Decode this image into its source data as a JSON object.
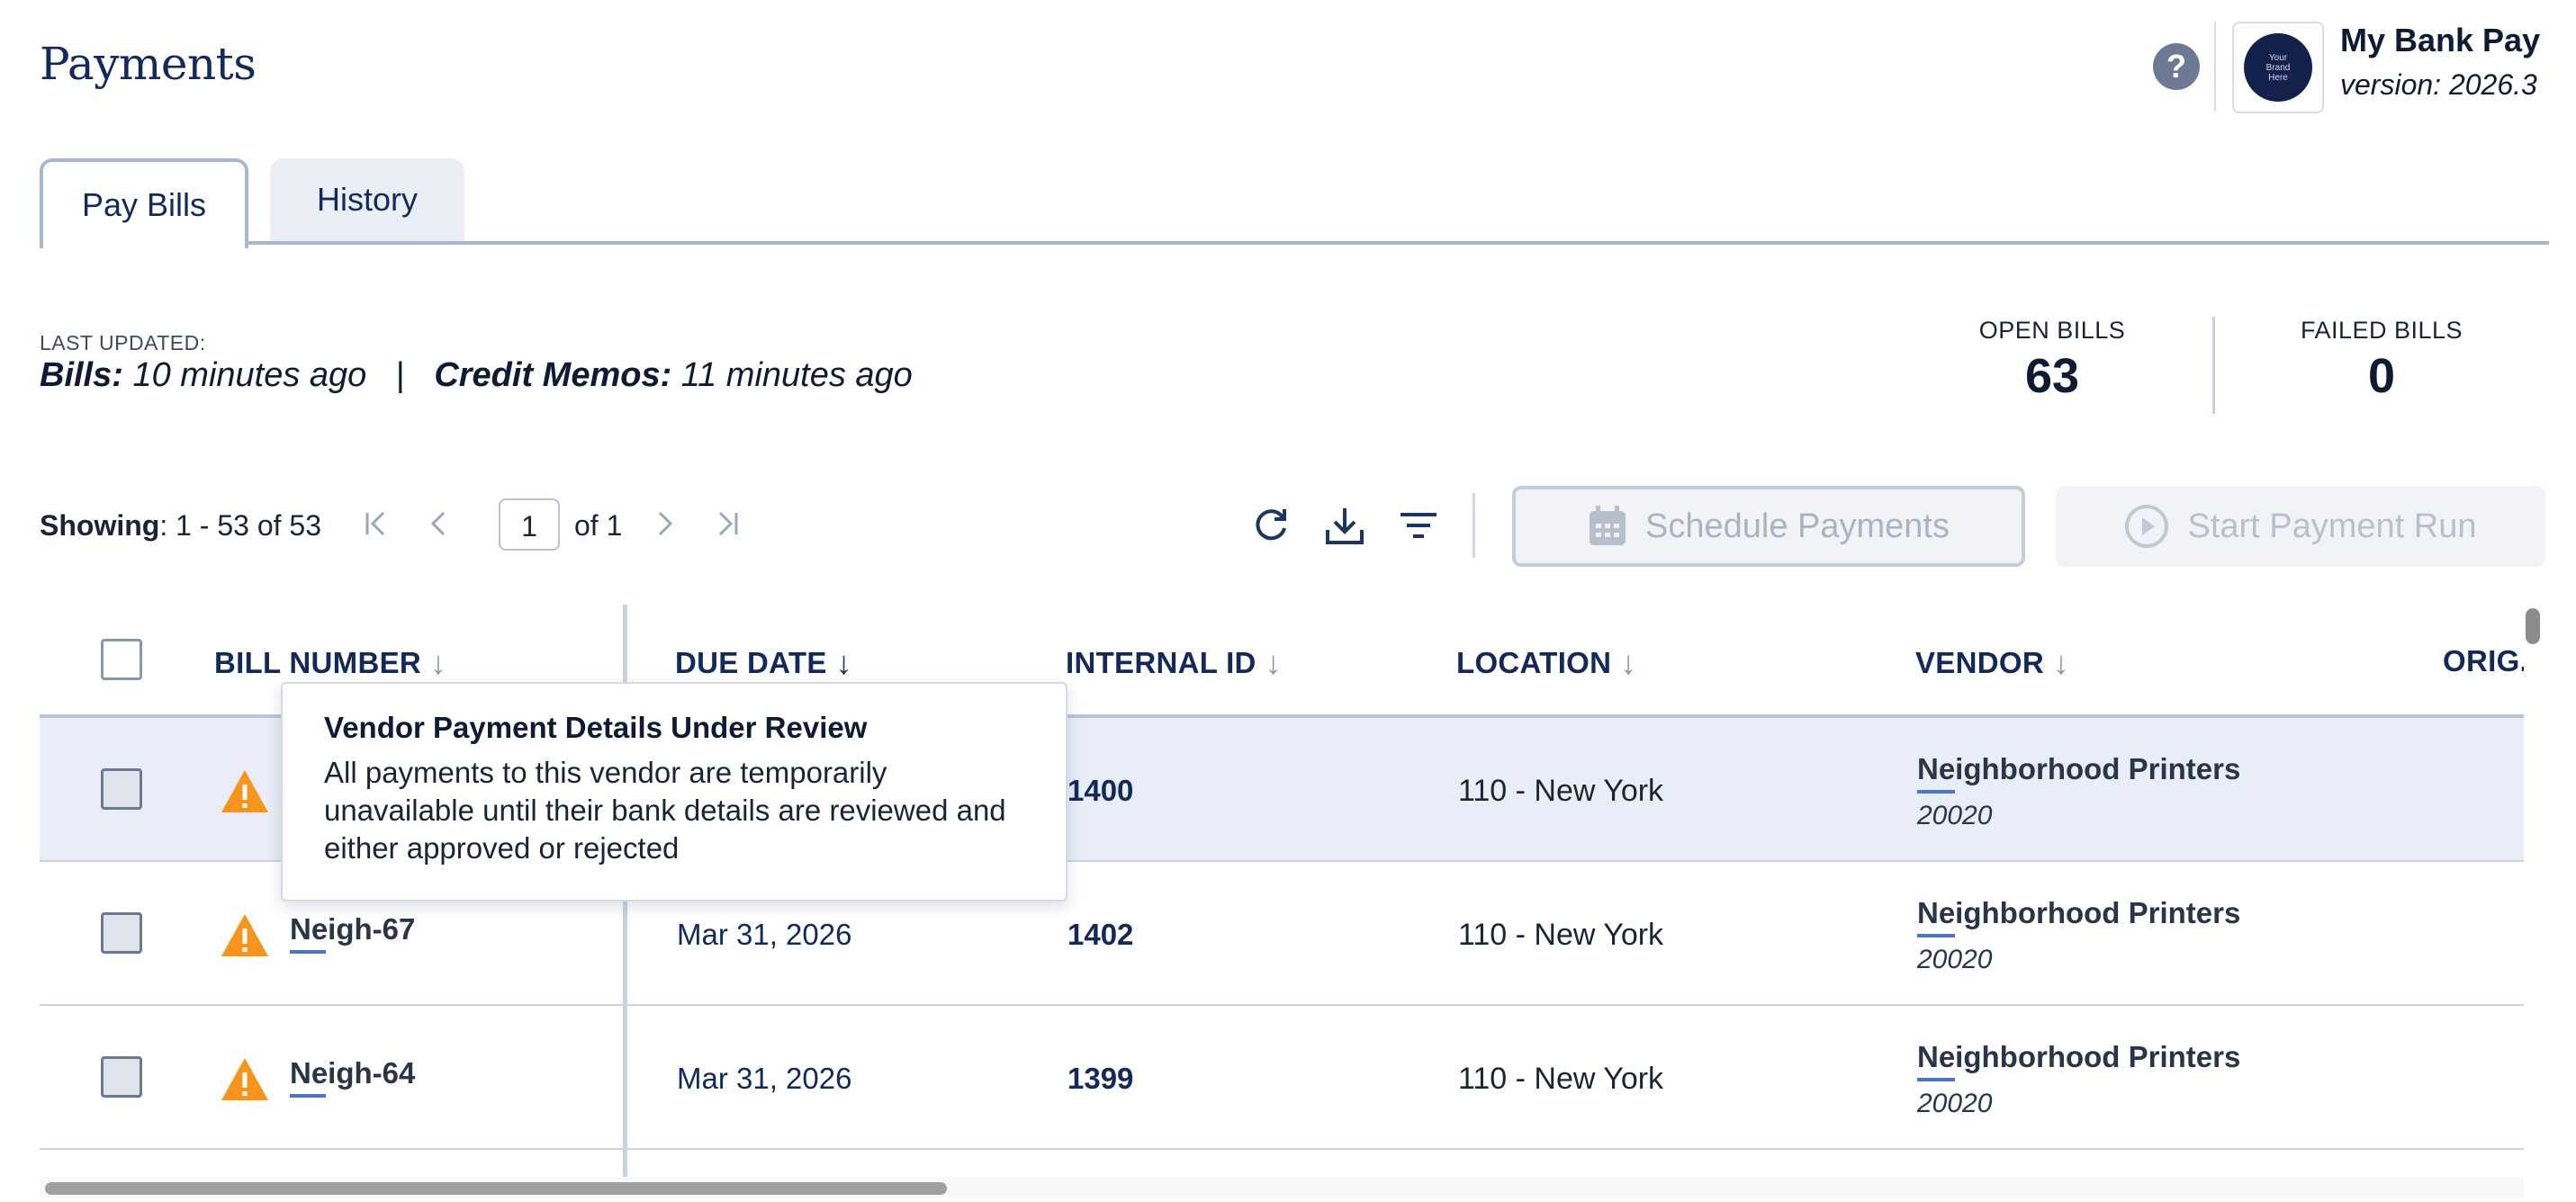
{
  "header": {
    "title": "Payments",
    "help_icon": "question-circle-icon",
    "brand_placeholder": [
      "Your",
      "Brand",
      "Here"
    ],
    "app_name": "My Bank Pay",
    "app_version": "version: 2026.3"
  },
  "tabs": [
    {
      "label": "Pay Bills",
      "active": true
    },
    {
      "label": "History",
      "active": false
    }
  ],
  "last_updated": {
    "label": "LAST UPDATED:",
    "bills_label": "Bills:",
    "bills_value": "10 minutes ago",
    "separator": "|",
    "memos_label": "Credit Memos:",
    "memos_value": "11 minutes ago"
  },
  "stats": {
    "open_bills_label": "OPEN BILLS",
    "open_bills_value": "63",
    "failed_bills_label": "FAILED BILLS",
    "failed_bills_value": "0"
  },
  "toolbar": {
    "showing_label": "Showing",
    "showing_value": ": 1 - 53 of 53",
    "current_page": "1",
    "page_of": "of 1",
    "schedule_label": "Schedule Payments",
    "start_run_label": "Start Payment Run"
  },
  "table": {
    "columns": [
      {
        "label": "BILL NUMBER",
        "sort": "desc"
      },
      {
        "label": "DUE DATE",
        "sort": "desc-active"
      },
      {
        "label": "INTERNAL ID",
        "sort": "desc"
      },
      {
        "label": "LOCATION",
        "sort": "desc"
      },
      {
        "label": "VENDOR",
        "sort": "desc"
      },
      {
        "label": "ORIG.",
        "sort": ""
      }
    ],
    "rows": [
      {
        "bill": "",
        "due": "",
        "internal_id": "1400",
        "location": "110 - New York",
        "vendor": "Neighborhood Printers",
        "vendor_id": "20020"
      },
      {
        "bill": "Neigh-67",
        "due": "Mar 31, 2026",
        "internal_id": "1402",
        "location": "110 - New York",
        "vendor": "Neighborhood Printers",
        "vendor_id": "20020"
      },
      {
        "bill": "Neigh-64",
        "due": "Mar 31, 2026",
        "internal_id": "1399",
        "location": "110 - New York",
        "vendor": "Neighborhood Printers",
        "vendor_id": "20020"
      }
    ]
  },
  "tooltip": {
    "title": "Vendor Payment Details Under Review",
    "body": "All payments to this vendor are temporarily unavailable until their bank details are reviewed and either approved or rejected"
  },
  "colors": {
    "navy": "#12295a",
    "warning": "#f7941d",
    "highlight_row": "#e8edf7",
    "underline_accent": "#4d74c9"
  }
}
